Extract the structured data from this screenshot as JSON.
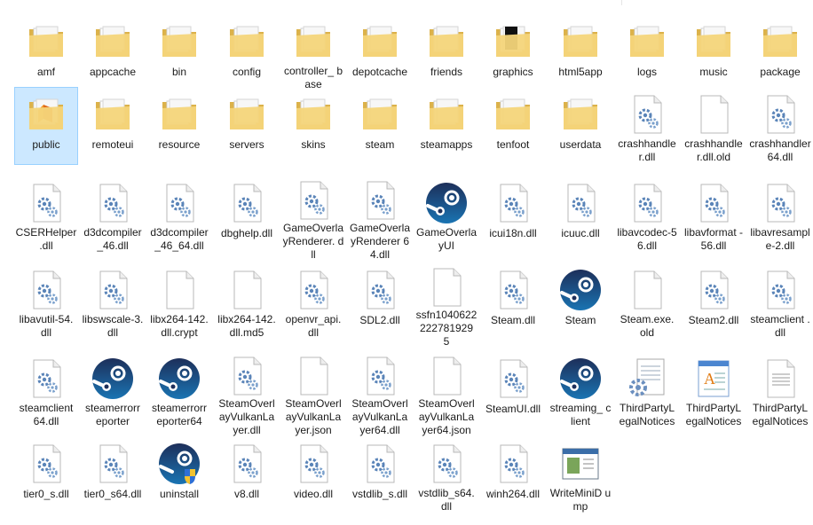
{
  "window": {
    "view": "large-icons"
  },
  "colors": {
    "folder": "#f4d57a",
    "folder_dark": "#dcb24a",
    "selection": "#cce8ff",
    "steam": "#1b3a63"
  },
  "items": [
    {
      "label": "amf",
      "icon": "folder",
      "row": 0,
      "col": 0
    },
    {
      "label": "appcache",
      "icon": "folder",
      "row": 0,
      "col": 1
    },
    {
      "label": "bin",
      "icon": "folder",
      "row": 0,
      "col": 2
    },
    {
      "label": "config",
      "icon": "folder",
      "row": 0,
      "col": 3
    },
    {
      "label": "controller_ base",
      "icon": "folder",
      "row": 0,
      "col": 4
    },
    {
      "label": "depotcache",
      "icon": "folder",
      "row": 0,
      "col": 5
    },
    {
      "label": "friends",
      "icon": "folder",
      "row": 0,
      "col": 6
    },
    {
      "label": "graphics",
      "icon": "folder-dark",
      "row": 0,
      "col": 7
    },
    {
      "label": "html5app",
      "icon": "folder",
      "row": 0,
      "col": 8
    },
    {
      "label": "logs",
      "icon": "folder",
      "row": 0,
      "col": 9
    },
    {
      "label": "music",
      "icon": "folder",
      "row": 0,
      "col": 10
    },
    {
      "label": "package",
      "icon": "folder",
      "row": 0,
      "col": 11
    },
    {
      "label": "public",
      "icon": "folder-special",
      "row": 1,
      "col": 0,
      "selected": true
    },
    {
      "label": "remoteui",
      "icon": "folder",
      "row": 1,
      "col": 1
    },
    {
      "label": "resource",
      "icon": "folder",
      "row": 1,
      "col": 2
    },
    {
      "label": "servers",
      "icon": "folder",
      "row": 1,
      "col": 3
    },
    {
      "label": "skins",
      "icon": "folder",
      "row": 1,
      "col": 4
    },
    {
      "label": "steam",
      "icon": "folder",
      "row": 1,
      "col": 5
    },
    {
      "label": "steamapps",
      "icon": "folder",
      "row": 1,
      "col": 6
    },
    {
      "label": "tenfoot",
      "icon": "folder",
      "row": 1,
      "col": 7
    },
    {
      "label": "userdata",
      "icon": "folder",
      "row": 1,
      "col": 8
    },
    {
      "label": "crashhandler.dll",
      "icon": "dll",
      "row": 1,
      "col": 9
    },
    {
      "label": "crashhandler.dll.old",
      "icon": "file",
      "row": 1,
      "col": 10
    },
    {
      "label": "crashhandler64.dll",
      "icon": "dll",
      "row": 1,
      "col": 11
    },
    {
      "label": "CSERHelper .dll",
      "icon": "dll",
      "row": 2,
      "col": 0
    },
    {
      "label": "d3dcompiler_46.dll",
      "icon": "dll",
      "row": 2,
      "col": 1
    },
    {
      "label": "d3dcompiler_46_64.dll",
      "icon": "dll",
      "row": 2,
      "col": 2
    },
    {
      "label": "dbghelp.dll",
      "icon": "dll",
      "row": 2,
      "col": 3
    },
    {
      "label": "GameOverlayRenderer. dll",
      "icon": "dll",
      "row": 2,
      "col": 4
    },
    {
      "label": "GameOverlayRenderer 64.dll",
      "icon": "dll",
      "row": 2,
      "col": 5
    },
    {
      "label": "GameOverlayUI",
      "icon": "steam",
      "row": 2,
      "col": 6
    },
    {
      "label": "icui18n.dll",
      "icon": "dll",
      "row": 2,
      "col": 7
    },
    {
      "label": "icuuc.dll",
      "icon": "dll",
      "row": 2,
      "col": 8
    },
    {
      "label": "libavcodec-56.dll",
      "icon": "dll",
      "row": 2,
      "col": 9
    },
    {
      "label": "libavformat -56.dll",
      "icon": "dll",
      "row": 2,
      "col": 10
    },
    {
      "label": "libavresample-2.dll",
      "icon": "dll",
      "row": 2,
      "col": 11
    },
    {
      "label": "libavutil-54. dll",
      "icon": "dll",
      "row": 3,
      "col": 0
    },
    {
      "label": "libswscale-3.dll",
      "icon": "dll",
      "row": 3,
      "col": 1
    },
    {
      "label": "libx264-142. dll.crypt",
      "icon": "file",
      "row": 3,
      "col": 2
    },
    {
      "label": "libx264-142. dll.md5",
      "icon": "file",
      "row": 3,
      "col": 3
    },
    {
      "label": "openvr_api. dll",
      "icon": "dll",
      "row": 3,
      "col": 4
    },
    {
      "label": "SDL2.dll",
      "icon": "dll",
      "row": 3,
      "col": 5
    },
    {
      "label": "ssfn1040622222781929 5",
      "icon": "file",
      "row": 3,
      "col": 6
    },
    {
      "label": "Steam.dll",
      "icon": "dll",
      "row": 3,
      "col": 7
    },
    {
      "label": "Steam",
      "icon": "steam",
      "row": 3,
      "col": 8
    },
    {
      "label": "Steam.exe. old",
      "icon": "file",
      "row": 3,
      "col": 9
    },
    {
      "label": "Steam2.dll",
      "icon": "dll",
      "row": 3,
      "col": 10
    },
    {
      "label": "steamclient .dll",
      "icon": "dll",
      "row": 3,
      "col": 11
    },
    {
      "label": "steamclient 64.dll",
      "icon": "dll",
      "row": 4,
      "col": 0
    },
    {
      "label": "steamerrorr eporter",
      "icon": "steam",
      "row": 4,
      "col": 1
    },
    {
      "label": "steamerrorr eporter64",
      "icon": "steam",
      "row": 4,
      "col": 2
    },
    {
      "label": "SteamOverl ayVulkanLa yer.dll",
      "icon": "dll",
      "row": 4,
      "col": 3
    },
    {
      "label": "SteamOverl ayVulkanLa yer.json",
      "icon": "file",
      "row": 4,
      "col": 4
    },
    {
      "label": "SteamOverl ayVulkanLa yer64.dll",
      "icon": "dll",
      "row": 4,
      "col": 5
    },
    {
      "label": "SteamOverl ayVulkanLa yer64.json",
      "icon": "file",
      "row": 4,
      "col": 6
    },
    {
      "label": "SteamUI.dll",
      "icon": "dll",
      "row": 4,
      "col": 7
    },
    {
      "label": "streaming_ client",
      "icon": "steam",
      "row": 4,
      "col": 8
    },
    {
      "label": "ThirdPartyL egalNotices",
      "icon": "doc-gear",
      "row": 4,
      "col": 9
    },
    {
      "label": "ThirdPartyL egalNotices",
      "icon": "wordpad",
      "row": 4,
      "col": 10
    },
    {
      "label": "ThirdPartyL egalNotices",
      "icon": "text",
      "row": 4,
      "col": 11
    },
    {
      "label": "tier0_s.dll",
      "icon": "dll",
      "row": 5,
      "col": 0
    },
    {
      "label": "tier0_s64.dll",
      "icon": "dll",
      "row": 5,
      "col": 1
    },
    {
      "label": "uninstall",
      "icon": "steam-shield",
      "row": 5,
      "col": 2
    },
    {
      "label": "v8.dll",
      "icon": "dll",
      "row": 5,
      "col": 3
    },
    {
      "label": "video.dll",
      "icon": "dll",
      "row": 5,
      "col": 4
    },
    {
      "label": "vstdlib_s.dll",
      "icon": "dll",
      "row": 5,
      "col": 5
    },
    {
      "label": "vstdlib_s64. dll",
      "icon": "dll",
      "row": 5,
      "col": 6
    },
    {
      "label": "winh264.dll",
      "icon": "dll",
      "row": 5,
      "col": 7
    },
    {
      "label": "WriteMiniD ump",
      "icon": "app-window",
      "row": 5,
      "col": 8
    }
  ]
}
